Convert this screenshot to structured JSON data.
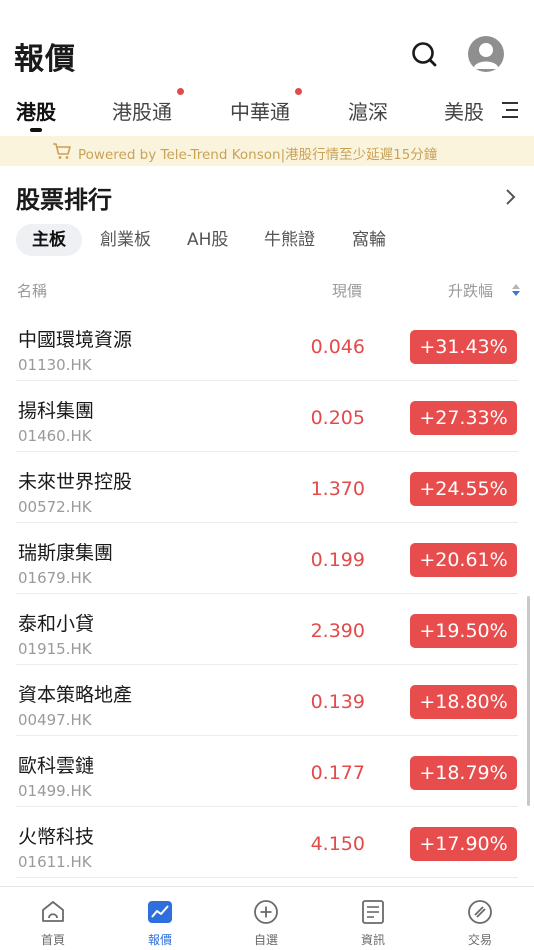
{
  "header": {
    "title": "報價"
  },
  "tabs": [
    {
      "label": "港股",
      "active": true,
      "dot": false
    },
    {
      "label": "港股通",
      "active": false,
      "dot": true
    },
    {
      "label": "中華通",
      "active": false,
      "dot": true
    },
    {
      "label": "滬深",
      "active": false,
      "dot": false
    },
    {
      "label": "美股",
      "active": false,
      "dot": false
    }
  ],
  "banner": {
    "text": "Powered by Tele-Trend Konson|港股行情至少延遲15分鐘"
  },
  "section": {
    "title": "股票排行"
  },
  "subtabs": [
    {
      "label": "主板",
      "active": true
    },
    {
      "label": "創業板",
      "active": false
    },
    {
      "label": "AH股",
      "active": false
    },
    {
      "label": "牛熊證",
      "active": false
    },
    {
      "label": "窩輪",
      "active": false
    }
  ],
  "columns": {
    "name": "名稱",
    "price": "現價",
    "change": "升跌幅"
  },
  "stocks": [
    {
      "name": "中國環境資源",
      "code": "01130.HK",
      "price": "0.046",
      "change": "+31.43%"
    },
    {
      "name": "揚科集團",
      "code": "01460.HK",
      "price": "0.205",
      "change": "+27.33%"
    },
    {
      "name": "未來世界控股",
      "code": "00572.HK",
      "price": "1.370",
      "change": "+24.55%"
    },
    {
      "name": "瑞斯康集團",
      "code": "01679.HK",
      "price": "0.199",
      "change": "+20.61%"
    },
    {
      "name": "泰和小貸",
      "code": "01915.HK",
      "price": "2.390",
      "change": "+19.50%"
    },
    {
      "name": "資本策略地產",
      "code": "00497.HK",
      "price": "0.139",
      "change": "+18.80%"
    },
    {
      "name": "歐科雲鏈",
      "code": "01499.HK",
      "price": "0.177",
      "change": "+18.79%"
    },
    {
      "name": "火幣科技",
      "code": "01611.HK",
      "price": "4.150",
      "change": "+17.90%"
    }
  ],
  "bottom_nav": [
    {
      "label": "首頁",
      "icon": "home-icon",
      "active": false
    },
    {
      "label": "報價",
      "icon": "quotes-chart-icon",
      "active": true
    },
    {
      "label": "自選",
      "icon": "add-watchlist-icon",
      "active": false
    },
    {
      "label": "資訊",
      "icon": "news-document-icon",
      "active": false
    },
    {
      "label": "交易",
      "icon": "trade-icon",
      "active": false
    }
  ],
  "colors": {
    "up": "#e84d4d",
    "accent": "#2f6fdc",
    "banner_bg": "#fbf4dc",
    "banner_text": "#c9a25a"
  }
}
